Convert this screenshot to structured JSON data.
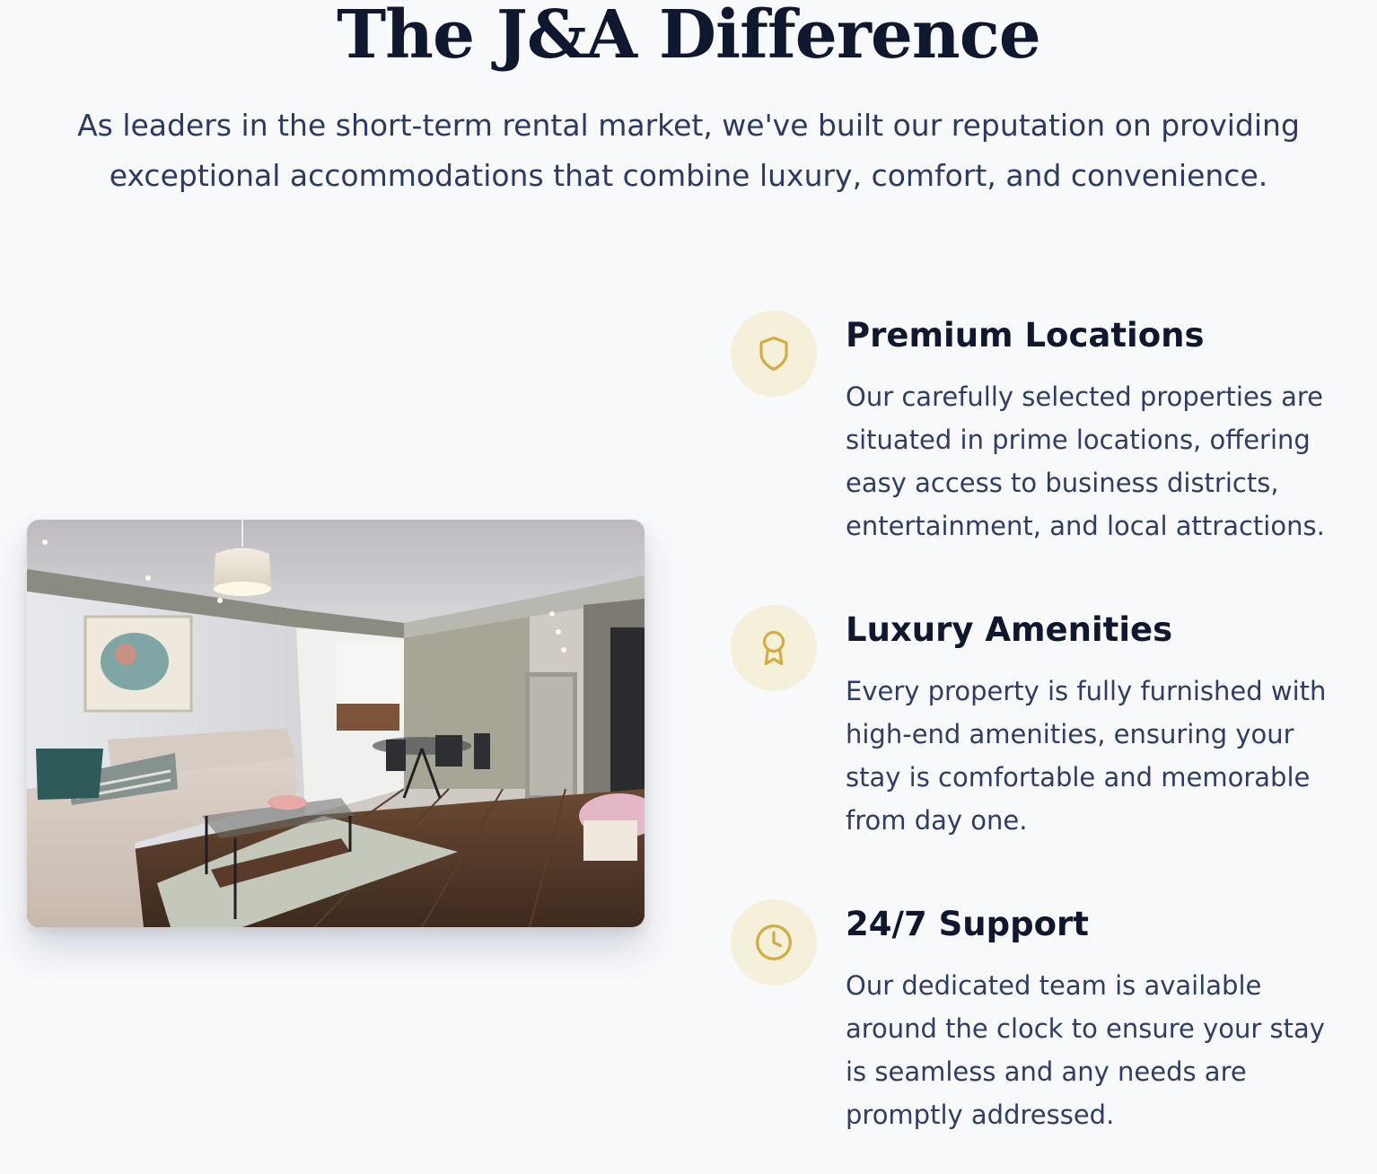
{
  "header": {
    "title": "The J&A Difference",
    "intro": "As leaders in the short-term rental market, we've built our reputation on providing exceptional accommodations that combine luxury, comfort, and convenience."
  },
  "image": {
    "alt": "Modern furnished apartment living room with kitchen"
  },
  "features": [
    {
      "icon": "shield-icon",
      "title": "Premium Locations",
      "text": "Our carefully selected properties are situated in prime locations, offering easy access to business districts, entertainment, and local attractions."
    },
    {
      "icon": "award-icon",
      "title": "Luxury Amenities",
      "text": "Every property is fully furnished with high-end amenities, ensuring your stay is comfortable and memorable from day one."
    },
    {
      "icon": "clock-icon",
      "title": "24/7 Support",
      "text": "Our dedicated team is available around the clock to ensure your stay is seamless and any needs are promptly addressed."
    }
  ],
  "colors": {
    "background": "#f8f9fb",
    "heading": "#10182f",
    "body_text": "#2f3c64",
    "icon_accent": "#d4ac45",
    "icon_circle": "#f5f0da"
  }
}
